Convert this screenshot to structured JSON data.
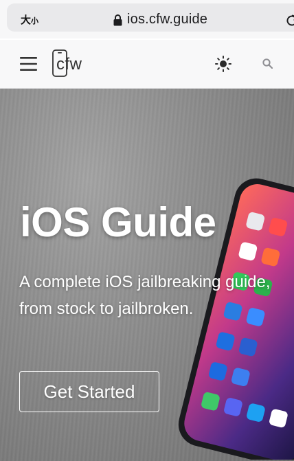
{
  "browser": {
    "text_size_big": "大",
    "text_size_small": "小",
    "url": "ios.cfw.guide",
    "icons": {
      "lock": "lock-icon",
      "reload": "reload-icon"
    }
  },
  "header": {
    "logo_text": "cfw",
    "icons": {
      "menu": "menu-icon",
      "theme": "sun-icon",
      "search": "search-icon"
    }
  },
  "hero": {
    "title": "iOS Guide",
    "subtitle": "A complete iOS jailbreaking guide, from stock to jailbroken.",
    "cta_label": "Get Started"
  },
  "colors": {
    "hero_text": "#ffffff",
    "header_bg": "#f8f8f9",
    "url_pill": "#e9e9eb"
  }
}
